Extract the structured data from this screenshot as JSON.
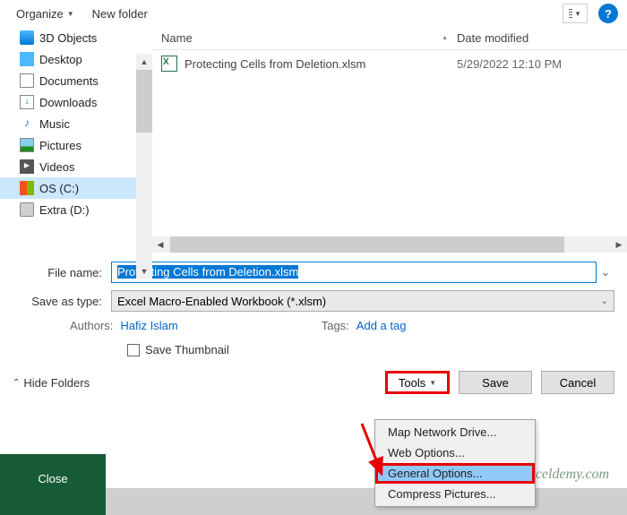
{
  "toolbar": {
    "organize": "Organize",
    "new_folder": "New folder"
  },
  "sidebar": {
    "items": [
      {
        "label": "3D Objects"
      },
      {
        "label": "Desktop"
      },
      {
        "label": "Documents"
      },
      {
        "label": "Downloads"
      },
      {
        "label": "Music"
      },
      {
        "label": "Pictures"
      },
      {
        "label": "Videos"
      },
      {
        "label": "OS (C:)"
      },
      {
        "label": "Extra (D:)"
      }
    ]
  },
  "file_pane": {
    "col_name": "Name",
    "col_date": "Date modified",
    "rows": [
      {
        "name": "Protecting Cells from Deletion.xlsm",
        "date": "5/29/2022 12:10 PM"
      }
    ]
  },
  "form": {
    "file_name_label": "File name:",
    "file_name_value": "Protecting Cells from Deletion.xlsm",
    "save_type_label": "Save as type:",
    "save_type_value": "Excel Macro-Enabled Workbook (*.xlsm)",
    "authors_label": "Authors:",
    "authors_value": "Hafiz Islam",
    "tags_label": "Tags:",
    "tags_value": "Add a tag",
    "save_thumbnail": "Save Thumbnail"
  },
  "footer": {
    "hide_folders": "Hide Folders",
    "tools": "Tools",
    "save": "Save",
    "cancel": "Cancel"
  },
  "tools_menu": {
    "items": [
      "Map Network Drive...",
      "Web Options...",
      "General Options...",
      "Compress Pictures..."
    ]
  },
  "close_strip": "Close",
  "watermark": "exceldemy.com"
}
